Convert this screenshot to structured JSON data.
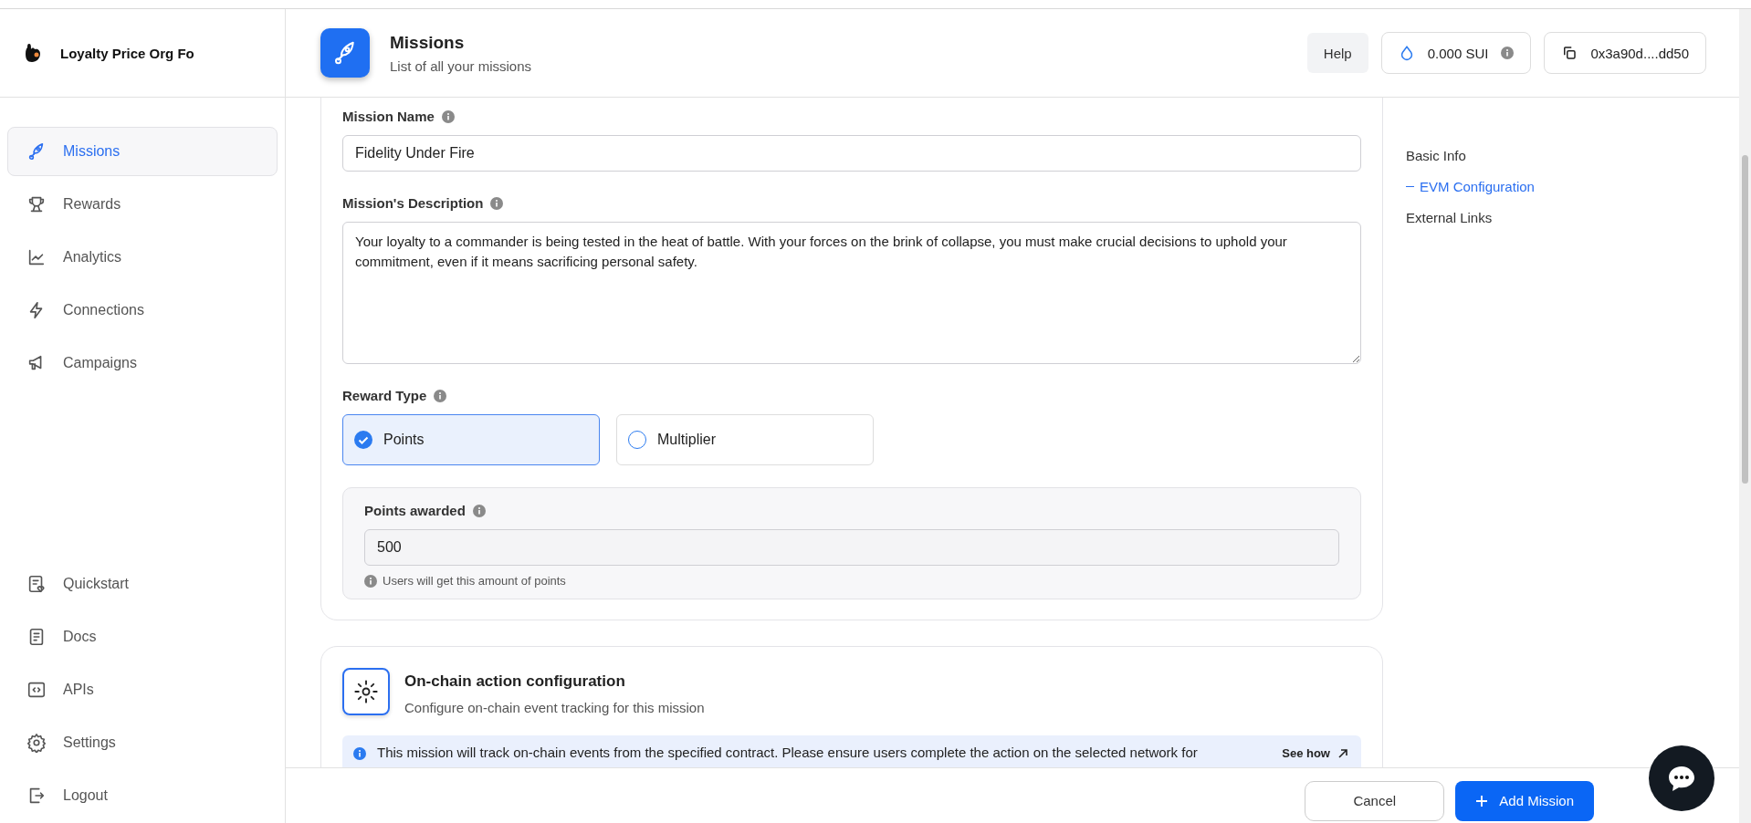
{
  "sidebar": {
    "org_name": "Loyalty Price Org Fo",
    "items": [
      {
        "label": "Missions",
        "selected": true
      },
      {
        "label": "Rewards",
        "selected": false
      },
      {
        "label": "Analytics",
        "selected": false
      },
      {
        "label": "Connections",
        "selected": false
      },
      {
        "label": "Campaigns",
        "selected": false
      }
    ],
    "bottom_items": [
      {
        "label": "Quickstart"
      },
      {
        "label": "Docs"
      },
      {
        "label": "APIs"
      },
      {
        "label": "Settings"
      },
      {
        "label": "Logout"
      }
    ]
  },
  "header": {
    "title": "Missions",
    "subtitle": "List of all your missions",
    "help": "Help",
    "balance": "0.000 SUI",
    "wallet": "0x3a90d....dd50"
  },
  "form": {
    "mission_name": {
      "label": "Mission Name",
      "value": "Fidelity Under Fire"
    },
    "description": {
      "label": "Mission's Description",
      "value": "Your loyalty to a commander is being tested in the heat of battle. With your forces on the brink of collapse, you must make crucial decisions to uphold your commitment, even if it means sacrificing personal safety."
    },
    "reward_type": {
      "label": "Reward Type",
      "options": [
        {
          "label": "Points",
          "selected": true
        },
        {
          "label": "Multiplier",
          "selected": false
        }
      ]
    },
    "points_awarded": {
      "label": "Points awarded",
      "value": "500",
      "hint": "Users will get this amount of points"
    }
  },
  "onchain": {
    "title": "On-chain action configuration",
    "subtitle": "Configure on-chain event tracking for this mission",
    "notice": "This mission will track on-chain events from the specified contract. Please ensure users complete the action on the selected network for",
    "link": "See how"
  },
  "toc": [
    {
      "label": "Basic Info",
      "selected": false
    },
    {
      "label": "EVM Configuration",
      "selected": true
    },
    {
      "label": "External Links",
      "selected": false
    }
  ],
  "footer": {
    "cancel": "Cancel",
    "submit": "Add Mission"
  }
}
